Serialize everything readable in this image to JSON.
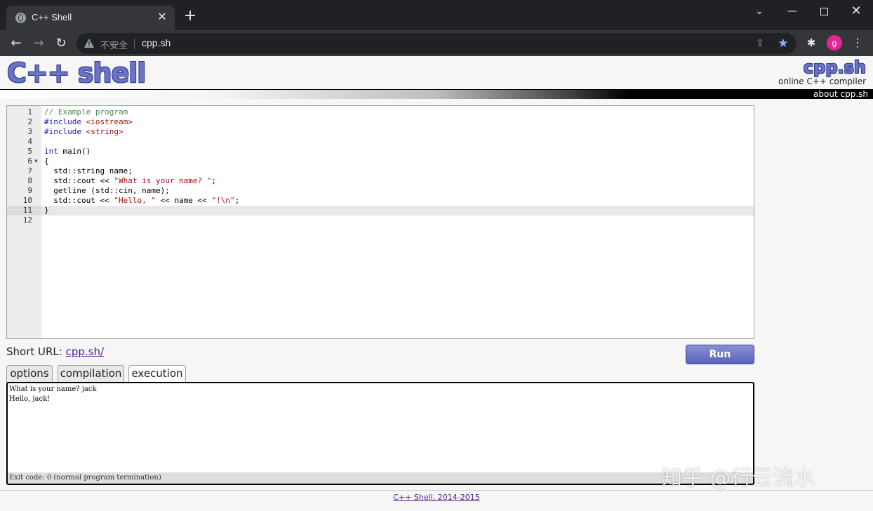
{
  "browser": {
    "tab_title": "C++ Shell",
    "insecure_label": "不安全",
    "url": "cpp.sh",
    "profile_initial": "g"
  },
  "site": {
    "logo": "C++ shell",
    "brand": "cpp.sh",
    "tagline": "online C++ compiler",
    "about_link": "about cpp.sh"
  },
  "editor": {
    "active_line": 11,
    "lines": [
      {
        "n": "1",
        "text": "// Example program"
      },
      {
        "n": "2",
        "text": "#include <iostream>"
      },
      {
        "n": "3",
        "text": "#include <string>"
      },
      {
        "n": "4",
        "text": ""
      },
      {
        "n": "5",
        "text": "int main()"
      },
      {
        "n": "6",
        "text": "{"
      },
      {
        "n": "7",
        "text": "  std::string name;"
      },
      {
        "n": "8",
        "text": "  std::cout << \"What is your name? \";"
      },
      {
        "n": "9",
        "text": "  getline (std::cin, name);"
      },
      {
        "n": "10",
        "text": "  std::cout << \"Hello, \" << name << \"!\\n\";"
      },
      {
        "n": "11",
        "text": "}"
      },
      {
        "n": "12",
        "text": ""
      }
    ]
  },
  "short_url": {
    "label": "Short URL:",
    "link": "cpp.sh/"
  },
  "run_label": "Run",
  "panel_tabs": [
    {
      "label": "options"
    },
    {
      "label": "compilation"
    },
    {
      "label": "execution"
    }
  ],
  "output": {
    "lines": "What is your name? jack\nHello, jack!",
    "exit": "Exit code: 0 (normal program termination)"
  },
  "footer": "C++ Shell, 2014-2015",
  "watermark": "知乎 @行云流水"
}
